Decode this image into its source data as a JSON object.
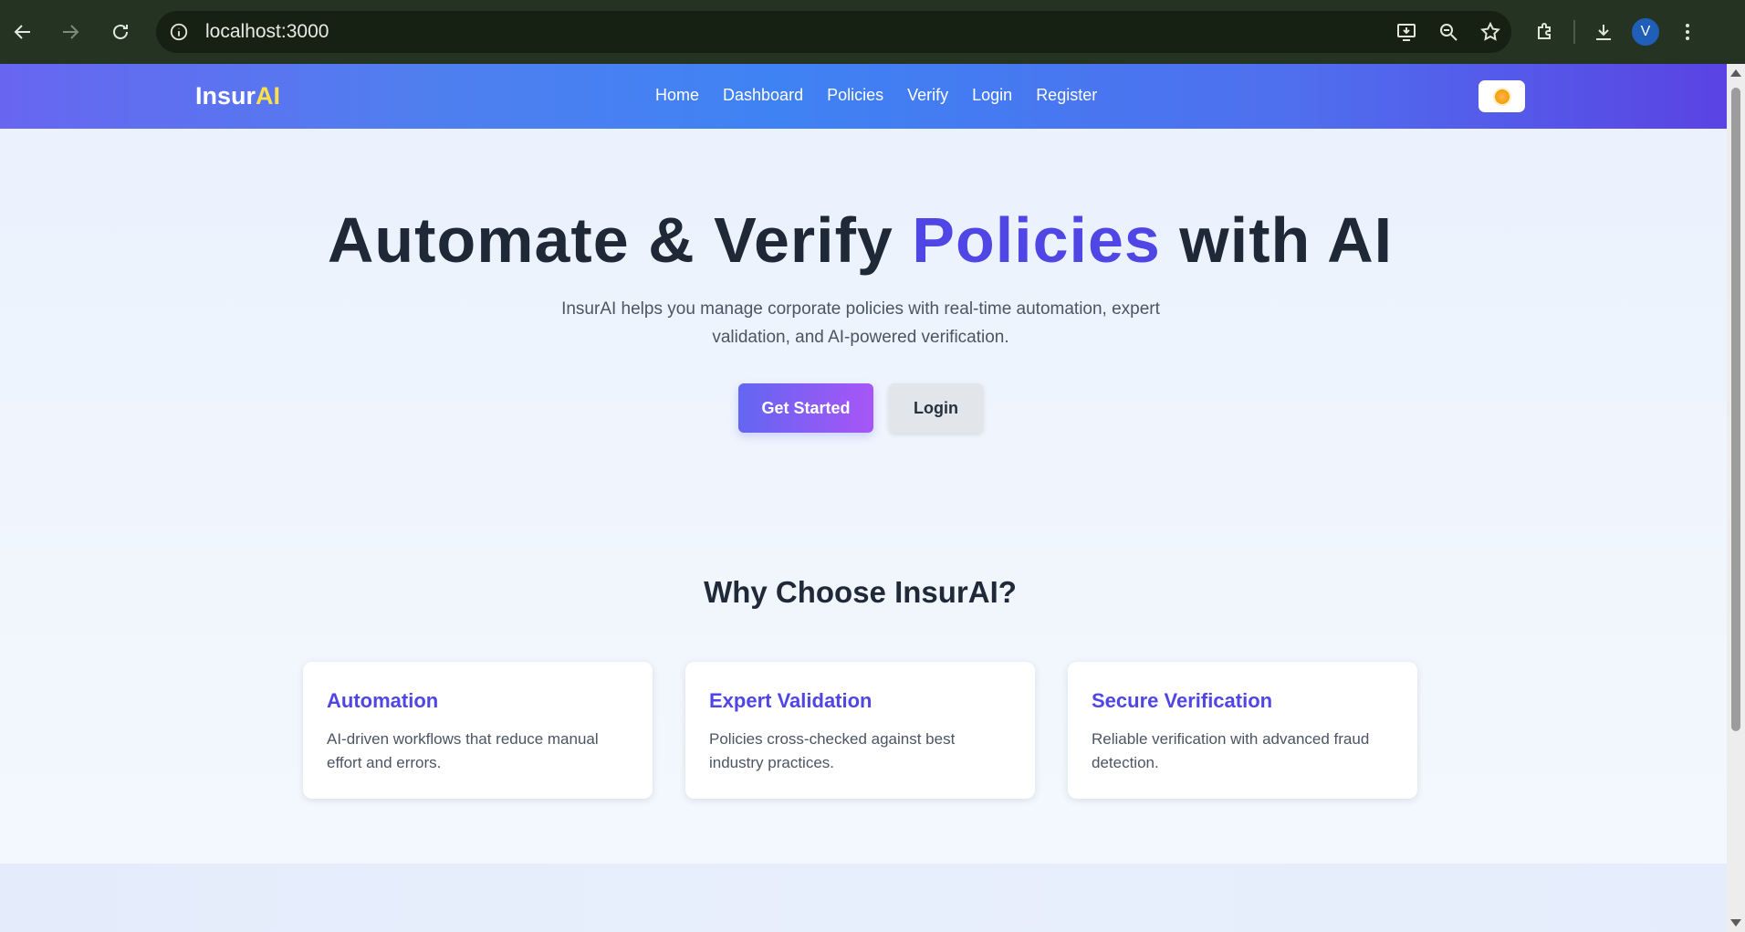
{
  "browser": {
    "url": "localhost:3000",
    "profile_initial": "V",
    "icons": {
      "back": "back-arrow-icon",
      "forward": "forward-arrow-icon",
      "reload": "reload-icon",
      "site_info": "info-icon",
      "install": "install-app-icon",
      "zoom": "zoom-icon",
      "bookmark": "star-icon",
      "extensions": "puzzle-icon",
      "downloads": "download-icon",
      "menu": "kebab-menu-icon"
    }
  },
  "navbar": {
    "brand_main": "Insur",
    "brand_accent": "AI",
    "links": [
      "Home",
      "Dashboard",
      "Policies",
      "Verify",
      "Login",
      "Register"
    ],
    "theme_toggle_icon": "sun-icon"
  },
  "hero": {
    "title_part1": "Automate & Verify ",
    "title_accent": "Policies",
    "title_part2": " with AI",
    "subtitle": "InsurAI helps you manage corporate policies with real-time automation, expert validation, and AI-powered verification.",
    "primary_button": "Get Started",
    "secondary_button": "Login"
  },
  "features": {
    "title": "Why Choose InsurAI?",
    "cards": [
      {
        "title": "Automation",
        "text": "AI-driven workflows that reduce manual effort and errors."
      },
      {
        "title": "Expert Validation",
        "text": "Policies cross-checked against best industry practices."
      },
      {
        "title": "Secure Verification",
        "text": "Reliable verification with advanced fraud detection."
      }
    ]
  },
  "colors": {
    "accent": "#5046e5",
    "brand_yellow": "#fde047",
    "text_dark": "#1e2836",
    "chrome_bg": "#253322"
  }
}
